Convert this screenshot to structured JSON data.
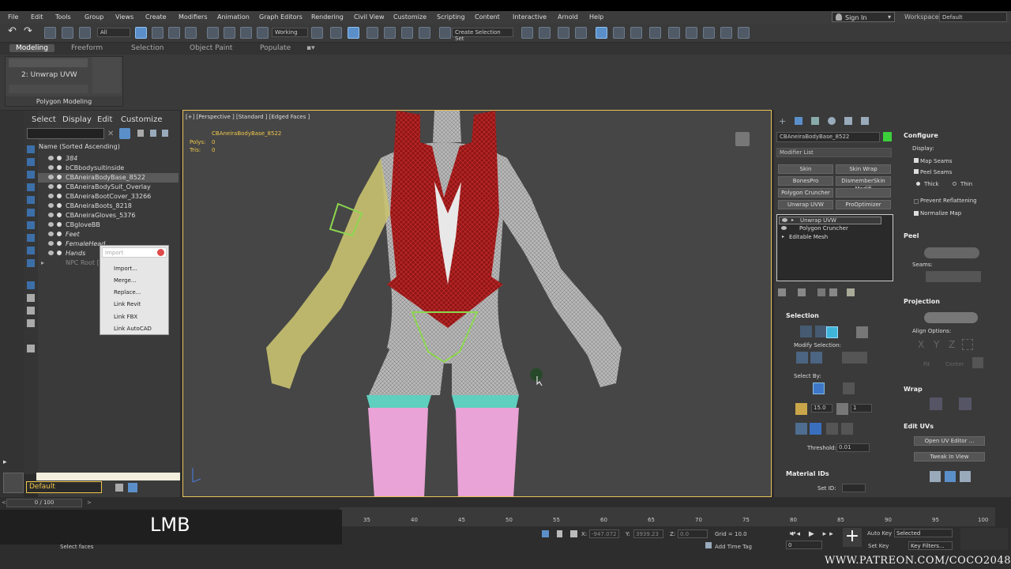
{
  "menu": [
    "File",
    "Edit",
    "Tools",
    "Group",
    "Views",
    "Create",
    "Modifiers",
    "Animation",
    "Graph Editors",
    "Rendering",
    "Civil View",
    "Customize",
    "Scripting",
    "Content",
    "Interactive",
    "Arnold",
    "Help"
  ],
  "account": {
    "sign_in": "Sign In",
    "workspaces_label": "Workspaces:",
    "workspace": "Default"
  },
  "toolbar": {
    "filter": "All",
    "coord": "Working",
    "selection_set": "Create Selection Set"
  },
  "ribbon": {
    "tabs": [
      "Modeling",
      "Freeform",
      "Selection",
      "Object Paint",
      "Populate"
    ],
    "modifier": "2: Unwrap UVW",
    "panel_label": "Polygon Modeling"
  },
  "scene_explorer": {
    "tabs": [
      "Select",
      "Display",
      "Edit",
      "Customize"
    ],
    "header": "Name (Sorted Ascending)",
    "items": [
      "384",
      "bCBbodysuitinside",
      "CBAneiraBodyBase_8522",
      "CBAneiraBodySuit_Overlay",
      "CBAneiraBootCover_33266",
      "CBAneiraBoots_8218",
      "CBAneiraGloves_5376",
      "CBgloveBB",
      "Feet",
      "FemaleHead",
      "Hands",
      "NPC Root [R"
    ]
  },
  "context_menu": {
    "placeholder": "Import",
    "items": [
      "Import...",
      "Merge...",
      "Replace...",
      "Link Revit",
      "Link FBX",
      "Link AutoCAD"
    ]
  },
  "viewport": {
    "label": "[+] [Perspective ] [Standard ] [Edged Faces ]",
    "object": "CBAneiraBodyBase_8522",
    "polys_label": "Polys:",
    "polys": "0",
    "tris_label": "Tris:",
    "tris": "0"
  },
  "command_panel": {
    "object_name": "CBAneiraBodyBase_8522",
    "modifier_list": "Modifier List",
    "buttons": [
      "Skin",
      "Skin Wrap",
      "BonesPro",
      "DismemberSkin Modifi",
      "Polygon Cruncher",
      "",
      "Unwrap UVW",
      "ProOptimizer"
    ],
    "stack": [
      "Unwrap UVW",
      "Polygon Cruncher",
      "Editable Mesh"
    ],
    "selection": {
      "title": "Selection",
      "modify": "Modify Selection:",
      "select_by": "Select By:",
      "angle": "15.0",
      "count": "1",
      "threshold_label": "Threshold:",
      "threshold": "0.01"
    },
    "material_ids": {
      "title": "Material IDs",
      "set_id": "Set ID:"
    },
    "configure": {
      "title": "Configure",
      "display": "Display:",
      "map_seams": "Map Seams",
      "peel_seams": "Peel Seams",
      "thick": "Thick",
      "thin": "Thin",
      "prevent": "Prevent Reflattening",
      "normalize": "Normalize Map"
    },
    "peel": {
      "title": "Peel",
      "seams": "Seams:"
    },
    "projection": {
      "title": "Projection",
      "align": "Align Options:",
      "axes": [
        "X",
        "Y",
        "Z"
      ],
      "fit": "Fit",
      "center": "Center"
    },
    "wrap": {
      "title": "Wrap"
    },
    "edit_uvs": {
      "title": "Edit UVs",
      "open": "Open UV Editor ...",
      "tweak": "Tweak In View"
    }
  },
  "layer": "Default",
  "timeline": {
    "frame": "0 / 100",
    "ticks": [
      "35",
      "40",
      "45",
      "50",
      "55",
      "60",
      "65",
      "70",
      "75",
      "80",
      "85",
      "90",
      "95",
      "100"
    ]
  },
  "status": {
    "select_faces": "Select faces",
    "x_label": "X:",
    "x": "-947.072",
    "y_label": "Y:",
    "y": "3939.23",
    "z_label": "Z:",
    "z": "0.0",
    "grid": "Grid = 10.0",
    "add_time_tag": "Add Time Tag",
    "auto_key": "Auto Key",
    "selected": "Selected",
    "set_key": "Set Key",
    "key_filters": "Key Filters...",
    "frame_field": "0"
  },
  "overlay": {
    "lmb": "LMB",
    "watermark": "WWW.PATREON.COM/COCO2048"
  },
  "colors": {
    "accent": "#5b8fc9",
    "viewport_border": "#e7c35a",
    "vest": "#a31c1c",
    "stocking": "#e9a3d6",
    "garter": "#5fd0c0",
    "glove": "#c9c270"
  }
}
